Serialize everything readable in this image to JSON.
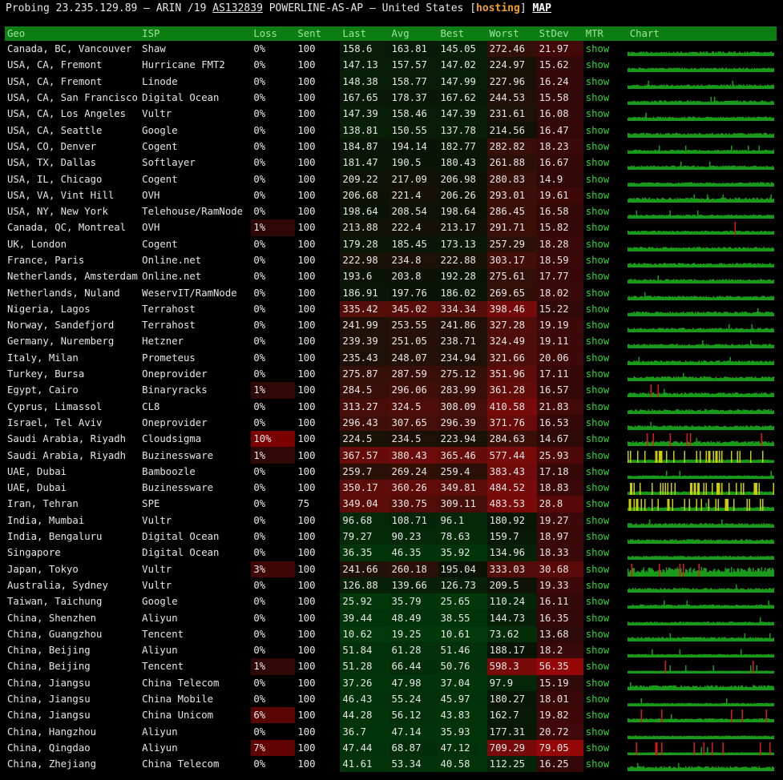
{
  "header": {
    "prefix": "Probing 23.235.129.89 – ARIN /19",
    "asn": "AS132839",
    "org": "POWERLINE-AS-AP – United States [",
    "tag": "hosting",
    "close": "]",
    "map": "MAP"
  },
  "columns": [
    "Geo",
    "ISP",
    "Loss",
    "Sent",
    "Last",
    "Avg",
    "Best",
    "Worst",
    "StDev",
    "MTR",
    "Chart"
  ],
  "colors": {
    "header_bg": "#0b7d12",
    "show_link": "#32d232",
    "chart_green": "#1a9a1a",
    "chart_yellow": "#cccc00",
    "chart_red": "#dd1a1a",
    "hosting": "#f0a020"
  },
  "rows": [
    {
      "geo": "Canada, BC, Vancouver",
      "isp": "Shaw",
      "loss": "0%",
      "sent": "100",
      "last": "158.6",
      "avg": "163.81",
      "best": "145.05",
      "worst": "272.46",
      "stdev": "21.97",
      "mtr": "show"
    },
    {
      "geo": "USA, CA, Fremont",
      "isp": "Hurricane FMT2",
      "loss": "0%",
      "sent": "100",
      "last": "147.13",
      "avg": "157.57",
      "best": "147.02",
      "worst": "224.97",
      "stdev": "15.62",
      "mtr": "show"
    },
    {
      "geo": "USA, CA, Fremont",
      "isp": "Linode",
      "loss": "0%",
      "sent": "100",
      "last": "148.38",
      "avg": "158.77",
      "best": "147.99",
      "worst": "227.96",
      "stdev": "16.24",
      "mtr": "show"
    },
    {
      "geo": "USA, CA, San Francisco",
      "isp": "Digital Ocean",
      "loss": "0%",
      "sent": "100",
      "last": "167.65",
      "avg": "178.37",
      "best": "167.62",
      "worst": "244.53",
      "stdev": "15.58",
      "mtr": "show"
    },
    {
      "geo": "USA, CA, Los Angeles",
      "isp": "Vultr",
      "loss": "0%",
      "sent": "100",
      "last": "147.39",
      "avg": "158.46",
      "best": "147.39",
      "worst": "231.61",
      "stdev": "16.08",
      "mtr": "show"
    },
    {
      "geo": "USA, CA, Seattle",
      "isp": "Google",
      "loss": "0%",
      "sent": "100",
      "last": "138.81",
      "avg": "150.55",
      "best": "137.78",
      "worst": "214.56",
      "stdev": "16.47",
      "mtr": "show"
    },
    {
      "geo": "USA, CO, Denver",
      "isp": "Cogent",
      "loss": "0%",
      "sent": "100",
      "last": "184.87",
      "avg": "194.14",
      "best": "182.77",
      "worst": "282.82",
      "stdev": "18.23",
      "mtr": "show"
    },
    {
      "geo": "USA, TX, Dallas",
      "isp": "Softlayer",
      "loss": "0%",
      "sent": "100",
      "last": "181.47",
      "avg": "190.5",
      "best": "180.43",
      "worst": "261.88",
      "stdev": "16.67",
      "mtr": "show"
    },
    {
      "geo": "USA, IL, Chicago",
      "isp": "Cogent",
      "loss": "0%",
      "sent": "100",
      "last": "209.22",
      "avg": "217.09",
      "best": "206.98",
      "worst": "280.83",
      "stdev": "14.9",
      "mtr": "show"
    },
    {
      "geo": "USA, VA, Vint Hill",
      "isp": "OVH",
      "loss": "0%",
      "sent": "100",
      "last": "206.68",
      "avg": "221.4",
      "best": "206.26",
      "worst": "293.01",
      "stdev": "19.61",
      "mtr": "show"
    },
    {
      "geo": "USA, NY, New York",
      "isp": "Telehouse/RamNode",
      "loss": "0%",
      "sent": "100",
      "last": "198.64",
      "avg": "208.54",
      "best": "198.64",
      "worst": "286.45",
      "stdev": "16.58",
      "mtr": "show"
    },
    {
      "geo": "Canada, QC, Montreal",
      "isp": "OVH",
      "loss": "1%",
      "sent": "100",
      "last": "213.88",
      "avg": "222.4",
      "best": "213.17",
      "worst": "291.71",
      "stdev": "15.82",
      "mtr": "show"
    },
    {
      "geo": "UK, London",
      "isp": "Cogent",
      "loss": "0%",
      "sent": "100",
      "last": "179.28",
      "avg": "185.45",
      "best": "173.13",
      "worst": "257.29",
      "stdev": "18.28",
      "mtr": "show"
    },
    {
      "geo": "France, Paris",
      "isp": "Online.net",
      "loss": "0%",
      "sent": "100",
      "last": "222.98",
      "avg": "234.8",
      "best": "222.88",
      "worst": "303.17",
      "stdev": "18.59",
      "mtr": "show"
    },
    {
      "geo": "Netherlands, Amsterdam",
      "isp": "Online.net",
      "loss": "0%",
      "sent": "100",
      "last": "193.6",
      "avg": "203.8",
      "best": "192.28",
      "worst": "275.61",
      "stdev": "17.77",
      "mtr": "show"
    },
    {
      "geo": "Netherlands, Nuland",
      "isp": "WeservIT/RamNode",
      "loss": "0%",
      "sent": "100",
      "last": "186.91",
      "avg": "197.76",
      "best": "186.02",
      "worst": "269.65",
      "stdev": "18.02",
      "mtr": "show"
    },
    {
      "geo": "Nigeria, Lagos",
      "isp": "Terrahost",
      "loss": "0%",
      "sent": "100",
      "last": "335.42",
      "avg": "345.02",
      "best": "334.34",
      "worst": "398.46",
      "stdev": "15.22",
      "mtr": "show"
    },
    {
      "geo": "Norway, Sandefjord",
      "isp": "Terrahost",
      "loss": "0%",
      "sent": "100",
      "last": "241.99",
      "avg": "253.55",
      "best": "241.86",
      "worst": "327.28",
      "stdev": "19.19",
      "mtr": "show"
    },
    {
      "geo": "Germany, Nuremberg",
      "isp": "Hetzner",
      "loss": "0%",
      "sent": "100",
      "last": "239.39",
      "avg": "251.05",
      "best": "238.71",
      "worst": "324.49",
      "stdev": "19.11",
      "mtr": "show"
    },
    {
      "geo": "Italy, Milan",
      "isp": "Prometeus",
      "loss": "0%",
      "sent": "100",
      "last": "235.43",
      "avg": "248.07",
      "best": "234.94",
      "worst": "321.66",
      "stdev": "20.06",
      "mtr": "show"
    },
    {
      "geo": "Turkey, Bursa",
      "isp": "Oneprovider",
      "loss": "0%",
      "sent": "100",
      "last": "275.87",
      "avg": "287.59",
      "best": "275.12",
      "worst": "351.96",
      "stdev": "17.11",
      "mtr": "show"
    },
    {
      "geo": "Egypt, Cairo",
      "isp": "Binaryracks",
      "loss": "1%",
      "sent": "100",
      "last": "284.5",
      "avg": "296.06",
      "best": "283.99",
      "worst": "361.28",
      "stdev": "16.57",
      "mtr": "show"
    },
    {
      "geo": "Cyprus, Limassol",
      "isp": "CL8",
      "loss": "0%",
      "sent": "100",
      "last": "313.27",
      "avg": "324.5",
      "best": "308.09",
      "worst": "410.58",
      "stdev": "21.83",
      "mtr": "show"
    },
    {
      "geo": "Israel, Tel Aviv",
      "isp": "Oneprovider",
      "loss": "0%",
      "sent": "100",
      "last": "296.43",
      "avg": "307.65",
      "best": "296.39",
      "worst": "371.76",
      "stdev": "16.53",
      "mtr": "show"
    },
    {
      "geo": "Saudi Arabia, Riyadh",
      "isp": "Cloudsigma",
      "loss": "10%",
      "sent": "100",
      "last": "224.5",
      "avg": "234.5",
      "best": "223.94",
      "worst": "284.63",
      "stdev": "14.67",
      "mtr": "show"
    },
    {
      "geo": "Saudi Arabia, Riyadh",
      "isp": "Buzinessware",
      "loss": "1%",
      "sent": "100",
      "last": "367.57",
      "avg": "380.43",
      "best": "365.46",
      "worst": "577.44",
      "stdev": "25.93",
      "mtr": "show"
    },
    {
      "geo": "UAE, Dubai",
      "isp": "Bamboozle",
      "loss": "0%",
      "sent": "100",
      "last": "259.7",
      "avg": "269.24",
      "best": "259.4",
      "worst": "383.43",
      "stdev": "17.18",
      "mtr": "show"
    },
    {
      "geo": "UAE, Dubai",
      "isp": "Buzinessware",
      "loss": "0%",
      "sent": "100",
      "last": "350.17",
      "avg": "360.26",
      "best": "349.81",
      "worst": "484.52",
      "stdev": "18.83",
      "mtr": "show"
    },
    {
      "geo": "Iran, Tehran",
      "isp": "SPE",
      "loss": "0%",
      "sent": "75",
      "last": "349.04",
      "avg": "330.75",
      "best": "309.11",
      "worst": "483.53",
      "stdev": "28.8",
      "mtr": "show"
    },
    {
      "geo": "India, Mumbai",
      "isp": "Vultr",
      "loss": "0%",
      "sent": "100",
      "last": "96.68",
      "avg": "108.71",
      "best": "96.1",
      "worst": "180.92",
      "stdev": "19.27",
      "mtr": "show"
    },
    {
      "geo": "India, Bengaluru",
      "isp": "Digital Ocean",
      "loss": "0%",
      "sent": "100",
      "last": "79.27",
      "avg": "90.23",
      "best": "78.63",
      "worst": "159.7",
      "stdev": "18.97",
      "mtr": "show"
    },
    {
      "geo": "Singapore",
      "isp": "Digital Ocean",
      "loss": "0%",
      "sent": "100",
      "last": "36.35",
      "avg": "46.35",
      "best": "35.92",
      "worst": "134.96",
      "stdev": "18.33",
      "mtr": "show"
    },
    {
      "geo": "Japan, Tokyo",
      "isp": "Vultr",
      "loss": "3%",
      "sent": "100",
      "last": "241.66",
      "avg": "260.18",
      "best": "195.04",
      "worst": "333.03",
      "stdev": "30.68",
      "mtr": "show"
    },
    {
      "geo": "Australia, Sydney",
      "isp": "Vultr",
      "loss": "0%",
      "sent": "100",
      "last": "126.88",
      "avg": "139.66",
      "best": "126.73",
      "worst": "209.5",
      "stdev": "19.33",
      "mtr": "show"
    },
    {
      "geo": "Taiwan, Taichung",
      "isp": "Google",
      "loss": "0%",
      "sent": "100",
      "last": "25.92",
      "avg": "35.79",
      "best": "25.65",
      "worst": "110.24",
      "stdev": "16.11",
      "mtr": "show"
    },
    {
      "geo": "China, Shenzhen",
      "isp": "Aliyun",
      "loss": "0%",
      "sent": "100",
      "last": "39.44",
      "avg": "48.49",
      "best": "38.55",
      "worst": "144.73",
      "stdev": "16.35",
      "mtr": "show"
    },
    {
      "geo": "China, Guangzhou",
      "isp": "Tencent",
      "loss": "0%",
      "sent": "100",
      "last": "10.62",
      "avg": "19.25",
      "best": "10.61",
      "worst": "73.62",
      "stdev": "13.68",
      "mtr": "show"
    },
    {
      "geo": "China, Beijing",
      "isp": "Aliyun",
      "loss": "0%",
      "sent": "100",
      "last": "51.84",
      "avg": "61.28",
      "best": "51.46",
      "worst": "188.17",
      "stdev": "18.2",
      "mtr": "show"
    },
    {
      "geo": "China, Beijing",
      "isp": "Tencent",
      "loss": "1%",
      "sent": "100",
      "last": "51.28",
      "avg": "66.44",
      "best": "50.76",
      "worst": "598.3",
      "stdev": "56.35",
      "mtr": "show"
    },
    {
      "geo": "China, Jiangsu",
      "isp": "China Telecom",
      "loss": "0%",
      "sent": "100",
      "last": "37.26",
      "avg": "47.98",
      "best": "37.04",
      "worst": "97.9",
      "stdev": "15.19",
      "mtr": "show"
    },
    {
      "geo": "China, Jiangsu",
      "isp": "China Mobile",
      "loss": "0%",
      "sent": "100",
      "last": "46.43",
      "avg": "55.24",
      "best": "45.97",
      "worst": "180.27",
      "stdev": "18.01",
      "mtr": "show"
    },
    {
      "geo": "China, Jiangsu",
      "isp": "China Unicom",
      "loss": "6%",
      "sent": "100",
      "last": "44.28",
      "avg": "56.12",
      "best": "43.83",
      "worst": "162.7",
      "stdev": "19.82",
      "mtr": "show"
    },
    {
      "geo": "China, Hangzhou",
      "isp": "Aliyun",
      "loss": "0%",
      "sent": "100",
      "last": "36.7",
      "avg": "47.14",
      "best": "35.93",
      "worst": "177.31",
      "stdev": "20.72",
      "mtr": "show"
    },
    {
      "geo": "China, Qingdao",
      "isp": "Aliyun",
      "loss": "7%",
      "sent": "100",
      "last": "47.44",
      "avg": "68.87",
      "best": "47.12",
      "worst": "709.29",
      "stdev": "79.05",
      "mtr": "show"
    },
    {
      "geo": "China, Zhejiang",
      "isp": "China Telecom",
      "loss": "0%",
      "sent": "100",
      "last": "41.61",
      "avg": "53.34",
      "best": "40.58",
      "worst": "112.25",
      "stdev": "16.25",
      "mtr": "show"
    }
  ]
}
